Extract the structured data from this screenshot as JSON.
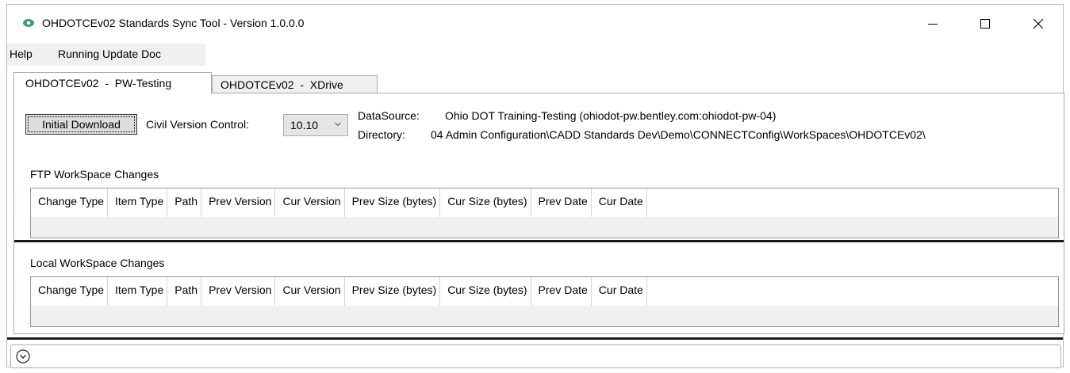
{
  "window": {
    "title": "OHDOTCEv02 Standards Sync Tool - Version 1.0.0.0",
    "icon": "app-eye-icon",
    "accent": "#3a9e7c"
  },
  "menu": {
    "items": [
      {
        "label": "Help"
      },
      {
        "label": "Running Update Doc"
      }
    ]
  },
  "tabs": [
    {
      "label": "OHDOTCEv02  -  PW-Testing",
      "active": true
    },
    {
      "label": "OHDOTCEv02  -  XDrive",
      "active": false
    }
  ],
  "controls": {
    "initial_download": "Initial Download",
    "civil_version_label": "Civil Version Control:",
    "civil_version_value": "10.10",
    "datasource_label": "DataSource:",
    "datasource_value": "Ohio DOT Training-Testing (ohiodot-pw.bentley.com:ohiodot-pw-04)",
    "directory_label": "Directory:",
    "directory_value": "04 Admin Configuration\\CADD Standards Dev\\Demo\\CONNECTConfig\\WorkSpaces\\OHDOTCEv02\\"
  },
  "ftp_section": {
    "label": "FTP WorkSpace Changes",
    "columns": [
      "Change Type",
      "Item Type",
      "Path",
      "Prev Version",
      "Cur Version",
      "Prev Size (bytes)",
      "Cur Size (bytes)",
      "Prev Date",
      "Cur Date"
    ]
  },
  "local_section": {
    "label": "Local WorkSpace Changes",
    "columns": [
      "Change Type",
      "Item Type",
      "Path",
      "Prev Version",
      "Cur Version",
      "Prev Size (bytes)",
      "Cur Size (bytes)",
      "Prev Date",
      "Cur Date"
    ]
  },
  "expander": {
    "icon": "chevron-down-circle-icon"
  }
}
